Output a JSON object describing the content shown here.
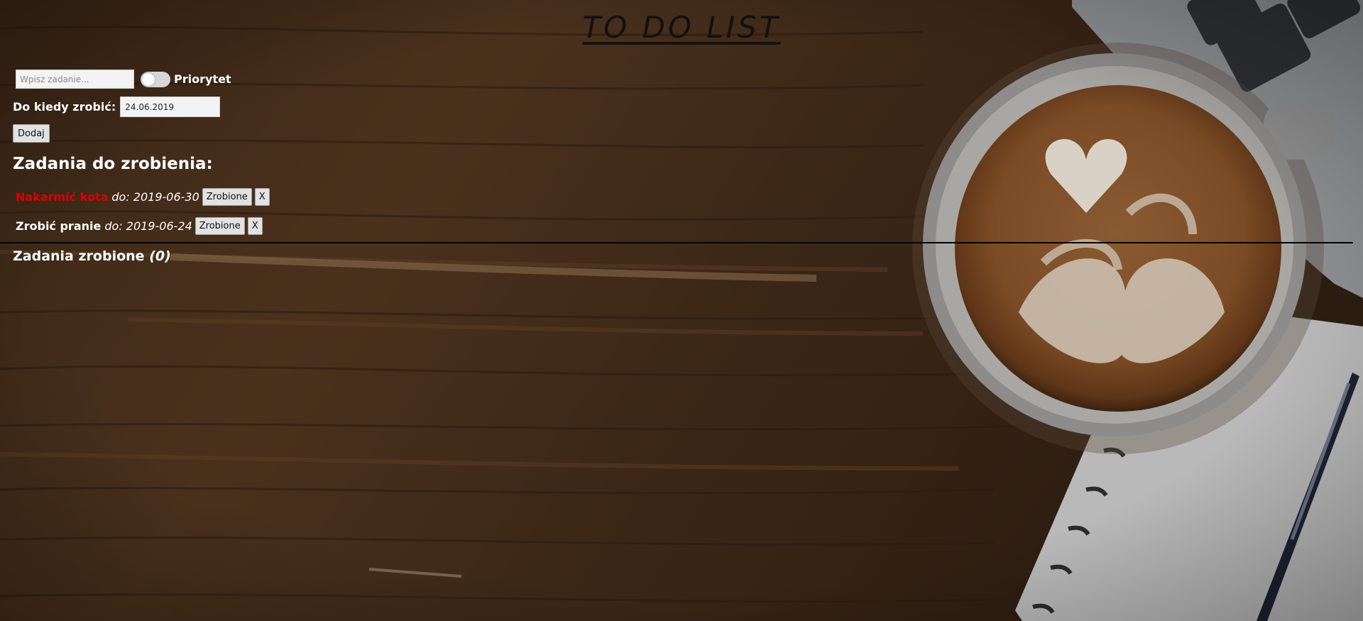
{
  "app": {
    "title": "TO DO LIST"
  },
  "form": {
    "task_placeholder": "Wpisz zadanie...",
    "task_value": "",
    "priority_label": "Priorytet",
    "priority_on": false,
    "due_label": "Do kiedy zrobić:",
    "due_value": "24.06.2019",
    "add_label": "Dodaj"
  },
  "todo": {
    "heading": "Zadania do zrobienia:",
    "tasks": [
      {
        "name": "Nakarmić kota",
        "due": "do: 2019-06-30",
        "priority": true,
        "done_label": "Zrobione",
        "delete_label": "X"
      },
      {
        "name": "Zrobić pranie",
        "due": "do: 2019-06-24",
        "priority": false,
        "done_label": "Zrobione",
        "delete_label": "X"
      }
    ]
  },
  "done": {
    "heading": "Zadania zrobione",
    "count": "(0)"
  },
  "colors": {
    "priority": "#dd0000",
    "text": "#ffffff",
    "title": "#111111"
  },
  "icons": {
    "toggle": "toggle-switch-icon"
  }
}
